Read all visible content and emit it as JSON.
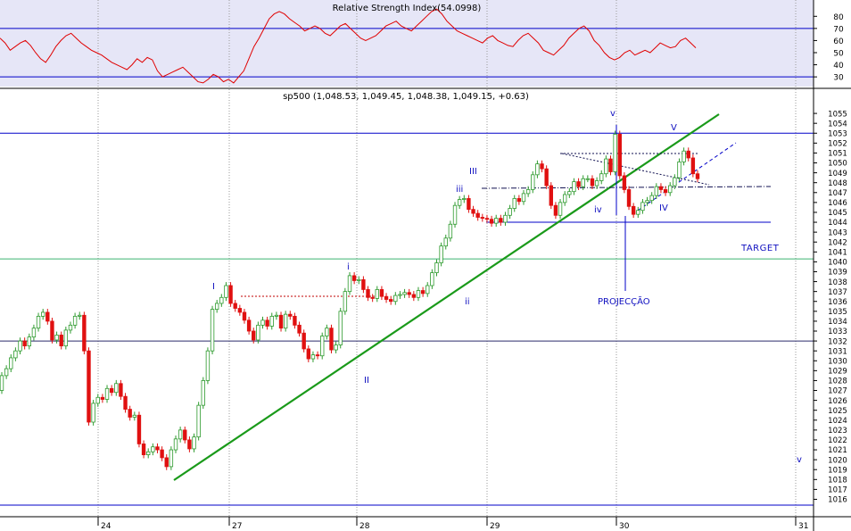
{
  "colors": {
    "rsi_bg": "#e6e6f7",
    "rsi_line": "#e00000",
    "level_line": "#0000c8",
    "trend_line": "#1a9a1a",
    "up_candle": "#2d9a2d",
    "down_candle": "#e01010",
    "grid": "#9a9a9a",
    "target_line": "#3cb371",
    "annotation": "#1010c0"
  },
  "rsi_panel": {
    "title": "Relative Strength Index(54.0998)",
    "ylim": [
      22,
      92
    ],
    "ticks": [
      "80",
      "70",
      "60",
      "50",
      "40",
      "30"
    ],
    "levels": [
      70,
      30
    ]
  },
  "price_panel": {
    "title": "sp500 (1,048.53, 1,049.45, 1,048.38, 1,049.15, +0.63)",
    "ylim": [
      1014.6,
      1056.0
    ],
    "price_ticks": [
      "1055",
      "1054",
      "1053",
      "1052",
      "1051",
      "1050",
      "1049",
      "1048",
      "1047",
      "1046",
      "1045",
      "1044",
      "1043",
      "1042",
      "1041",
      "1040",
      "1039",
      "1038",
      "1037",
      "1036",
      "1035",
      "1034",
      "1033",
      "1032",
      "1031",
      "1030",
      "1029",
      "1028",
      "1027",
      "1026",
      "1025",
      "1024",
      "1023",
      "1022",
      "1021",
      "1020",
      "1019",
      "1018",
      "1017",
      "1016"
    ],
    "date_ticks": [
      "24",
      "27",
      "28",
      "29",
      "30",
      "31"
    ],
    "labels": {
      "target": "TARGET",
      "projection": "PROJECÇÃO",
      "wave_I": "I",
      "wave_i": "i",
      "wave_II": "II",
      "wave_ii": "ii",
      "wave_III": "III",
      "wave_iii": "iii",
      "wave_iv": "iv",
      "wave_IV": "IV",
      "wave_v": "v",
      "wave_V": "V",
      "wave_v2": "v"
    }
  },
  "chart_data": {
    "type": "line",
    "x_type": "intraday session index (dates 23–31)",
    "date_labels": [
      "24",
      "27",
      "28",
      "29",
      "30",
      "31"
    ],
    "rsi": {
      "title": "Relative Strength Index(54.0998)",
      "values": [
        62,
        58,
        52,
        55,
        58,
        60,
        56,
        50,
        45,
        42,
        48,
        55,
        60,
        64,
        66,
        62,
        58,
        55,
        52,
        50,
        48,
        45,
        42,
        40,
        38,
        36,
        40,
        45,
        42,
        46,
        44,
        35,
        30,
        32,
        34,
        36,
        38,
        34,
        30,
        26,
        25,
        28,
        32,
        30,
        26,
        28,
        25,
        30,
        35,
        45,
        55,
        62,
        70,
        78,
        82,
        84,
        82,
        78,
        75,
        72,
        68,
        70,
        72,
        70,
        66,
        64,
        68,
        72,
        74,
        70,
        66,
        62,
        60,
        62,
        64,
        68,
        72,
        74,
        76,
        72,
        70,
        68,
        72,
        76,
        80,
        84,
        86,
        82,
        76,
        72,
        68,
        66,
        64,
        62,
        60,
        58,
        62,
        64,
        60,
        58,
        56,
        55,
        60,
        64,
        66,
        62,
        58,
        52,
        50,
        48,
        52,
        56,
        62,
        66,
        70,
        72,
        68,
        60,
        56,
        50,
        46,
        44,
        46,
        50,
        52,
        48,
        50,
        52,
        50,
        54,
        58,
        56,
        54,
        55,
        60,
        62,
        58,
        54
      ],
      "levels": [
        70,
        30
      ]
    },
    "price": {
      "title": "sp500 (1,048.53, 1,049.45, 1,048.38, 1,049.15, +0.63)",
      "open": [
        1027.0,
        1028.5,
        1029.2,
        1030.3,
        1031.0,
        1032.0,
        1031.5,
        1032.4,
        1033.3,
        1034.5,
        1034.9,
        1034.0,
        1032.1,
        1032.6,
        1031.5,
        1033.1,
        1033.6,
        1034.5,
        1034.6,
        1031.0,
        1023.8,
        1025.7,
        1026.3,
        1026.1,
        1027.2,
        1026.8,
        1027.7,
        1026.4,
        1025.1,
        1024.3,
        1024.5,
        1021.6,
        1020.5,
        1020.8,
        1021.3,
        1021.0,
        1020.2,
        1019.3,
        1021.0,
        1022.1,
        1023.0,
        1022.0,
        1021.1,
        1022.3,
        1025.5,
        1028.0,
        1031.0,
        1035.2,
        1035.8,
        1036.4,
        1037.6,
        1035.8,
        1035.3,
        1034.9,
        1034.1,
        1033.0,
        1032.1,
        1033.6,
        1034.1,
        1033.5,
        1034.5,
        1034.6,
        1033.3,
        1034.7,
        1034.5,
        1033.6,
        1032.8,
        1031.2,
        1030.2,
        1030.6,
        1030.5,
        1032.5,
        1033.3,
        1031.1,
        1031.6,
        1035.0,
        1037.0,
        1038.6,
        1038.1,
        1038.2,
        1037.2,
        1036.4,
        1036.3,
        1037.2,
        1036.5,
        1036.2,
        1036.0,
        1036.6,
        1036.7,
        1036.9,
        1036.7,
        1036.4,
        1037.1,
        1036.8,
        1037.6,
        1038.9,
        1039.9,
        1041.6,
        1042.4,
        1043.8,
        1045.7,
        1046.3,
        1046.4,
        1045.3,
        1044.9,
        1044.5,
        1044.4,
        1044.3,
        1043.9,
        1044.4,
        1044.0,
        1044.7,
        1045.4,
        1046.4,
        1046.1,
        1046.9,
        1047.3,
        1048.8,
        1049.9,
        1049.4,
        1047.7,
        1045.7,
        1044.7,
        1046.0,
        1046.8,
        1047.1,
        1048.1,
        1047.6,
        1048.4,
        1048.4,
        1047.7,
        1048.2,
        1048.9,
        1050.4,
        1049.1,
        1052.9,
        1048.7,
        1047.3,
        1045.6,
        1044.8,
        1045.2,
        1046.0,
        1046.2,
        1046.7,
        1047.6,
        1047.3,
        1047.0,
        1047.7,
        1048.5,
        1050.1,
        1051.2,
        1050.5,
        1048.9
      ],
      "close": [
        1028.5,
        1029.2,
        1030.3,
        1031.0,
        1032.0,
        1031.5,
        1032.4,
        1033.3,
        1034.5,
        1034.9,
        1034.0,
        1032.1,
        1032.6,
        1031.5,
        1033.1,
        1033.6,
        1034.5,
        1034.6,
        1031.0,
        1023.8,
        1025.7,
        1026.3,
        1026.1,
        1027.2,
        1026.8,
        1027.7,
        1026.4,
        1025.1,
        1024.3,
        1024.5,
        1021.6,
        1020.5,
        1020.8,
        1021.3,
        1021.0,
        1020.2,
        1019.3,
        1021.0,
        1022.1,
        1023.0,
        1022.0,
        1021.1,
        1022.3,
        1025.5,
        1028.0,
        1031.0,
        1035.2,
        1035.8,
        1036.4,
        1037.6,
        1035.8,
        1035.3,
        1034.9,
        1034.1,
        1033.0,
        1032.1,
        1033.6,
        1034.1,
        1033.5,
        1034.5,
        1034.6,
        1033.3,
        1034.7,
        1034.5,
        1033.6,
        1032.8,
        1031.2,
        1030.2,
        1030.6,
        1030.5,
        1032.5,
        1033.3,
        1031.1,
        1031.6,
        1035.0,
        1037.0,
        1038.6,
        1038.1,
        1038.2,
        1037.2,
        1036.4,
        1036.3,
        1037.2,
        1036.5,
        1036.2,
        1036.0,
        1036.6,
        1036.7,
        1036.9,
        1036.7,
        1036.4,
        1037.1,
        1036.8,
        1037.6,
        1038.9,
        1039.9,
        1041.6,
        1042.4,
        1043.8,
        1045.7,
        1046.3,
        1046.4,
        1045.3,
        1044.9,
        1044.5,
        1044.4,
        1044.3,
        1043.9,
        1044.4,
        1044.0,
        1044.7,
        1045.4,
        1046.4,
        1046.1,
        1046.9,
        1047.3,
        1048.8,
        1049.9,
        1049.4,
        1047.7,
        1045.7,
        1044.7,
        1046.0,
        1046.8,
        1047.1,
        1048.1,
        1047.6,
        1048.4,
        1048.4,
        1047.7,
        1048.2,
        1048.9,
        1050.4,
        1049.1,
        1052.9,
        1048.7,
        1047.3,
        1045.6,
        1044.8,
        1045.2,
        1046.0,
        1046.2,
        1046.7,
        1047.6,
        1047.3,
        1047.0,
        1047.7,
        1048.5,
        1050.1,
        1051.2,
        1050.5,
        1048.9,
        1048.4
      ],
      "horizontal_levels": [
        1053.0,
        1044.0,
        1032.0,
        1040.3
      ],
      "target": 1040.3
    }
  }
}
